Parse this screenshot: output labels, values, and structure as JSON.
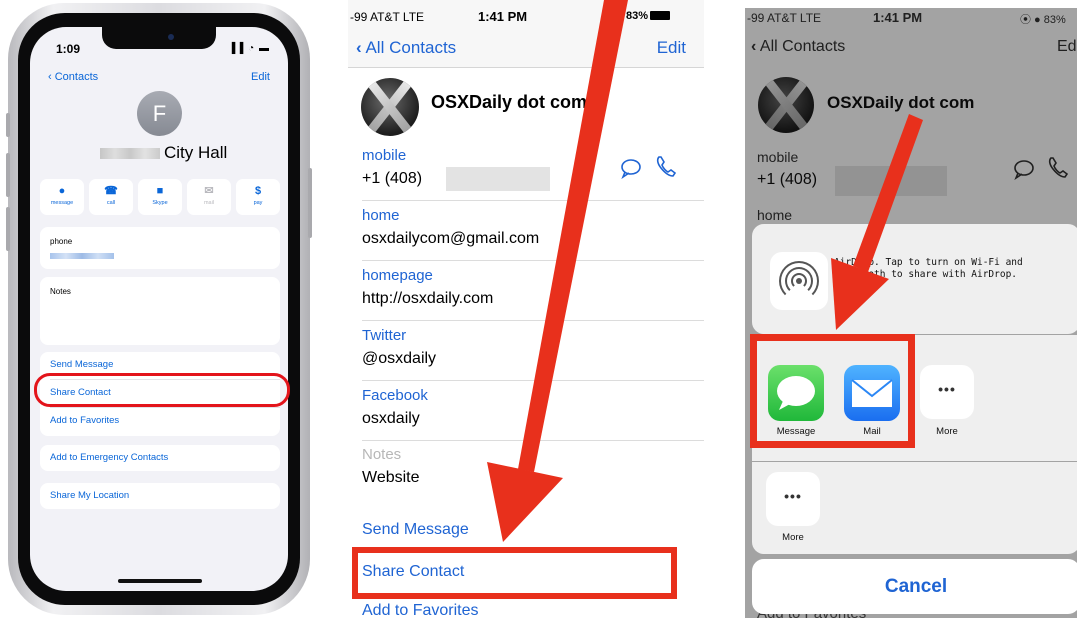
{
  "panel1": {
    "time": "1:09",
    "status_icons": "▐▐ ◔ ▬",
    "back_label": "Contacts",
    "edit_label": "Edit",
    "avatar_initial": "F",
    "name_visible": "City Hall",
    "actions": [
      {
        "icon": "speech-bubble",
        "glyph": "●",
        "label": "message",
        "enabled": true
      },
      {
        "icon": "phone",
        "glyph": "☎",
        "label": "call",
        "enabled": true
      },
      {
        "icon": "video-camera",
        "glyph": "■",
        "label": "Skype",
        "enabled": true
      },
      {
        "icon": "envelope",
        "glyph": "✉",
        "label": "mail",
        "enabled": false
      },
      {
        "icon": "dollar",
        "glyph": "$",
        "label": "pay",
        "enabled": true
      }
    ],
    "phone_label": "phone",
    "notes_label": "Notes",
    "links": [
      "Send Message",
      "Share Contact",
      "Add to Favorites"
    ],
    "emergency_label": "Add to Emergency Contacts",
    "location_label": "Share My Location",
    "highlight_color": "#e3141b"
  },
  "panel2": {
    "carrier": "-99 AT&T  LTE",
    "time": "1:41 PM",
    "battery": "83%",
    "back_label": "All Contacts",
    "edit_label": "Edit",
    "contact_name": "OSXDaily dot com",
    "fields": [
      {
        "label": "mobile",
        "value": "+1 (408)"
      },
      {
        "label": "home",
        "value": "osxdailycom@gmail.com"
      },
      {
        "label": "homepage",
        "value": "http://osxdaily.com"
      },
      {
        "label": "Twitter",
        "value": "@osxdaily"
      },
      {
        "label": "Facebook",
        "value": "osxdaily"
      }
    ],
    "notes_label": "Notes",
    "notes_value": "Website",
    "buttons": [
      "Send Message",
      "Share Contact",
      "Add to Favorites"
    ],
    "accent_color": "#1f64d3",
    "arrow_color": "#e8301c"
  },
  "panel3": {
    "carrier": "-99 AT&T  LTE",
    "time": "1:41 PM",
    "battery": "83%",
    "back_label": "All Contacts",
    "edit_label": "Edi",
    "contact_name": "OSXDaily dot com",
    "mobile_label": "mobile",
    "mobile_value": "+1 (408)",
    "home_label": "home",
    "airdrop_text": "AirDrop. Tap to turn on Wi-Fi and Bluetooth to share with AirDrop.",
    "apps": [
      {
        "name": "Message",
        "icon": "messages-app-icon"
      },
      {
        "name": "Mail",
        "icon": "mail-app-icon"
      },
      {
        "name": "More",
        "icon": "more-icon"
      }
    ],
    "actions_more_label": "More",
    "cancel_label": "Cancel",
    "underlying_text": "Add to Favorites"
  }
}
